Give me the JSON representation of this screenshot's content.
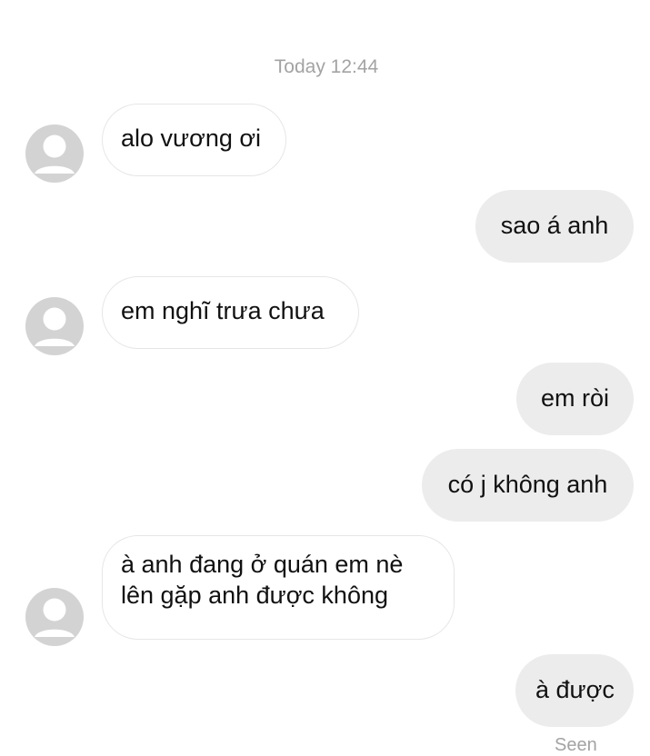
{
  "thread": {
    "timestamp": "Today 12:44",
    "seen_label": "Seen"
  },
  "messages": [
    {
      "direction": "incoming",
      "lines": [
        "alo vương ơi"
      ]
    },
    {
      "direction": "outgoing",
      "lines": [
        "sao á anh"
      ]
    },
    {
      "direction": "incoming",
      "lines": [
        "em nghĩ trưa chưa"
      ]
    },
    {
      "direction": "outgoing",
      "lines": [
        "em ròi"
      ]
    },
    {
      "direction": "outgoing",
      "lines": [
        "có j không anh"
      ]
    },
    {
      "direction": "incoming",
      "lines": [
        "à anh đang ở quán em nè",
        "lên gặp anh được không"
      ]
    },
    {
      "direction": "outgoing",
      "lines": [
        "à được"
      ]
    }
  ],
  "colors": {
    "incoming_bubble_bg": "#ffffff",
    "incoming_bubble_border": "#e6e6e6",
    "outgoing_bubble_bg": "#ececec",
    "avatar_bg": "#d3d3d3",
    "meta_text": "#a3a3a3"
  },
  "icons": {
    "avatar": "default-user-avatar-icon"
  }
}
